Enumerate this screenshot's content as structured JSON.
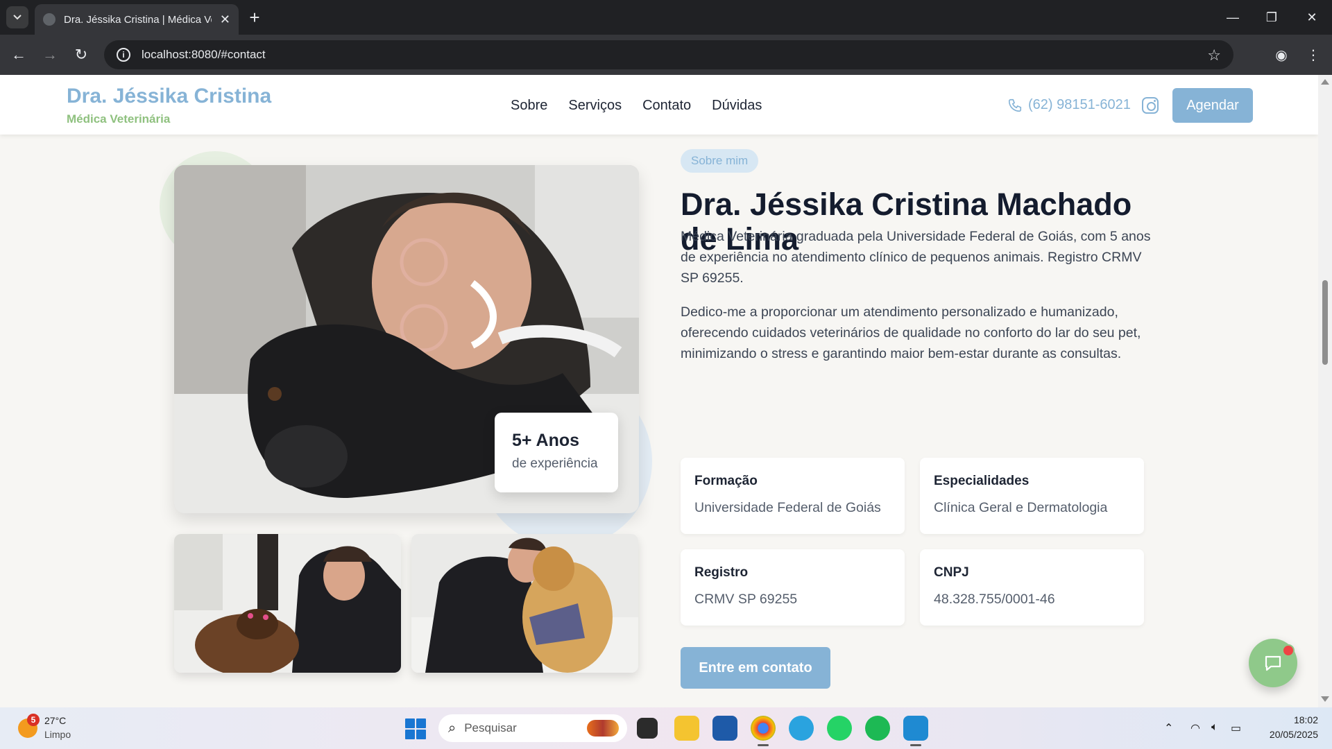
{
  "browser": {
    "tab_title": "Dra. Jéssika Cristina | Médica Veterinária",
    "url": "localhost:8080/#contact"
  },
  "header": {
    "brand_name": "Dra. Jéssika Cristina",
    "brand_subtitle": "Médica Veterinária",
    "nav": [
      "Sobre",
      "Serviços",
      "Contato",
      "Dúvidas"
    ],
    "phone": "(62) 98151-6021",
    "schedule_label": "Agendar"
  },
  "about": {
    "tag": "Sobre mim",
    "title": "Dra. Jéssika Cristina Machado de Lima",
    "paragraph1": "Médica Veterinária graduada pela Universidade Federal de Goiás, com 5 anos de experiência no atendimento clínico de pequenos animais. Registro CRMV SP 69255.",
    "paragraph2": "Dedico-me a proporcionar um atendimento personalizado e humanizado, oferecendo cuidados veterinários de qualidade no conforto do lar do seu pet, minimizando o stress e garantindo maior bem-estar durante as consultas.",
    "experience_value": "5+ Anos",
    "experience_label": "de experiência",
    "cards": [
      {
        "label": "Formação",
        "value": "Universidade Federal de Goiás"
      },
      {
        "label": "Especialidades",
        "value": "Clínica Geral e Dermatologia"
      },
      {
        "label": "Registro",
        "value": "CRMV SP 69255"
      },
      {
        "label": "CNPJ",
        "value": "48.328.755/0001-46"
      }
    ],
    "contact_button": "Entre em contato"
  },
  "taskbar": {
    "weather_badge": "5",
    "temperature": "27°C",
    "weather": "Limpo",
    "search_placeholder": "Pesquisar",
    "time": "18:02",
    "date": "20/05/2025"
  },
  "colors": {
    "accent_blue": "#86b3d6",
    "accent_green": "#8fc17f",
    "page_bg": "#f7f6f3"
  }
}
